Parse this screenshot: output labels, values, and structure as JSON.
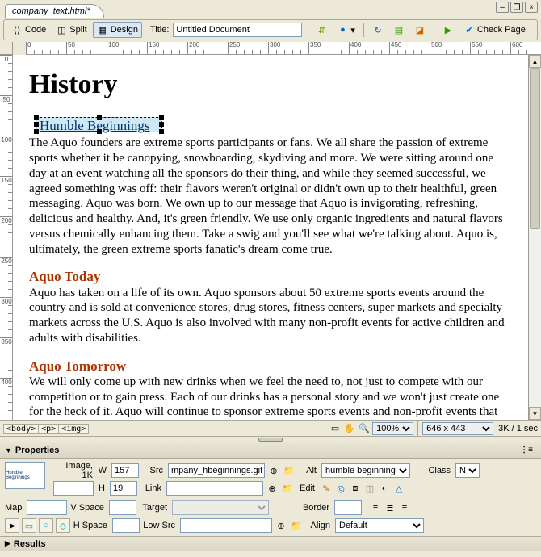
{
  "tab": {
    "filename": "company_text.html*"
  },
  "toolbar": {
    "code": "Code",
    "split": "Split",
    "design": "Design",
    "title_label": "Title:",
    "title_value": "Untitled Document",
    "check_page": "Check Page"
  },
  "ruler_h": [
    "0",
    "50",
    "100",
    "150",
    "200",
    "250",
    "300",
    "350",
    "400",
    "450",
    "500",
    "550",
    "600"
  ],
  "ruler_v": [
    "0",
    "50",
    "100",
    "150",
    "200",
    "250",
    "300",
    "350",
    "400"
  ],
  "document": {
    "h1": "History",
    "selected_image_text": "Humble Beginnings",
    "p1": "The Aquo founders are extreme sports participants or fans. We all share the passion of extreme sports whether it be canopying, snowboarding, skydiving and more. We were sitting around one day at an event watching all the sponsors do their thing, and while they seemed successful, we agreed something was off: their flavors weren't original or didn't own up to their healthful, green messaging. Aquo was born. We own up to our message that Aquo is invigorating, refreshing, delicious and healthy. And, it's green friendly. We use only organic ingredients and natural flavors versus chemically enhancing them. Take a swig and you'll see what we're talking about. Aquo is, ultimately, the green extreme sports fanatic's dream come true.",
    "h2a": "Aquo Today",
    "p2": "Aquo has taken on a life of its own. Aquo sponsors about 50 extreme sports events around the country and is sold at convenience stores, drug stores, fitness centers, super markets and specialty markets across the U.S. Aquo is also involved with many non-profit events for active children and adults with disabilities.",
    "h2b": "Aquo Tomorrow",
    "p3": "We will only come up with new drinks when we feel the need to, not just to compete with our competition or to gain press. Each of our drinks has a personal story and we won't just create one for the heck of it. Aquo will continue to sponsor extreme sports events and non-profit events that we"
  },
  "status": {
    "tags": [
      "<body>",
      "<p>",
      "<img>"
    ],
    "zoom": "100%",
    "dims": "646 x 443",
    "size_time": "3K / 1 sec"
  },
  "properties": {
    "title": "Properties",
    "image_label": "Image, 1K",
    "w_label": "W",
    "w_value": "157",
    "h_label": "H",
    "h_value": "19",
    "src_label": "Src",
    "src_value": "mpany_hbeginnings.gif",
    "link_label": "Link",
    "link_value": "",
    "alt_label": "Alt",
    "alt_value": "humble beginnings",
    "edit_label": "Edit",
    "class_label": "Class",
    "class_value": "Non",
    "map_label": "Map",
    "map_value": "",
    "vspace_label": "V Space",
    "vspace_value": "",
    "hspace_label": "H Space",
    "hspace_value": "",
    "target_label": "Target",
    "target_value": "",
    "lowsrc_label": "Low Src",
    "lowsrc_value": "",
    "border_label": "Border",
    "border_value": "",
    "align_label": "Align",
    "align_value": "Default"
  },
  "results": {
    "title": "Results"
  }
}
